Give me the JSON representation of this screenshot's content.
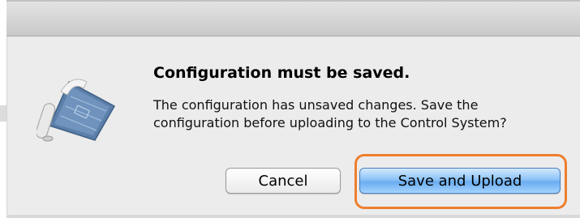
{
  "dialog": {
    "title": "Configuration must be saved.",
    "message": "The configuration has unsaved changes. Save the configuration before uploading to the Control System?",
    "icon": "blueprint-scroll-icon"
  },
  "buttons": {
    "cancel_label": "Cancel",
    "primary_label": "Save and Upload"
  },
  "colors": {
    "highlight": "#ee7f2e",
    "primary_button": "#8cc3f7",
    "dialog_background": "#ececec"
  }
}
